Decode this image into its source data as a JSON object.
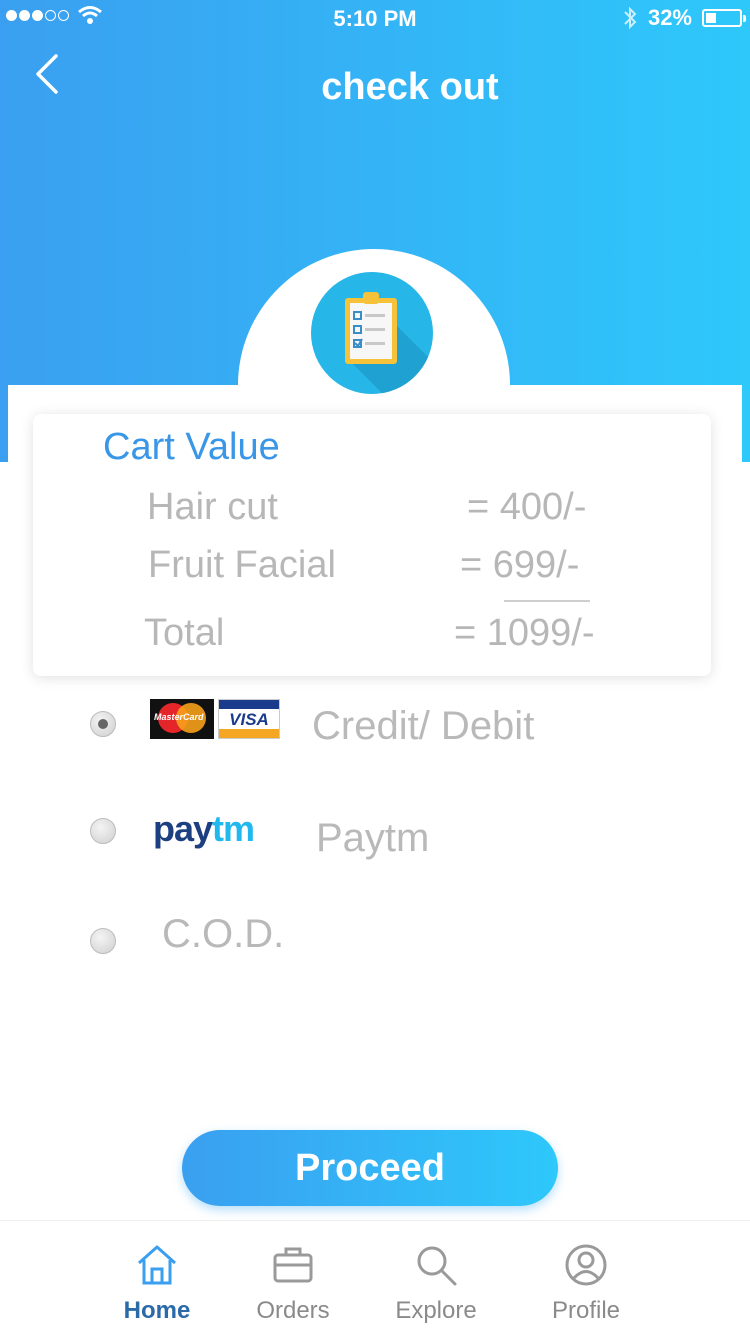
{
  "status_bar": {
    "time": "5:10 PM",
    "battery_percent": "32%",
    "battery_level": 0.32
  },
  "header": {
    "title": "check out"
  },
  "cart": {
    "title": "Cart Value",
    "items": [
      {
        "name": "Hair cut",
        "value": "= 400/-"
      },
      {
        "name": "Fruit Facial",
        "value": "= 699/-"
      }
    ],
    "total": {
      "name": "Total",
      "value": "= 1099/-"
    }
  },
  "payment": {
    "options": [
      {
        "label": "Credit/ Debit",
        "selected": true,
        "icons": [
          "mastercard-icon",
          "visa-icon"
        ]
      },
      {
        "label": "Paytm",
        "selected": false,
        "icons": [
          "paytm-icon"
        ]
      },
      {
        "label": "C.O.D.",
        "selected": false,
        "icons": []
      }
    ],
    "logo_text": {
      "mastercard": "MasterCard",
      "visa": "VISA",
      "paytm_pay": "pay",
      "paytm_tm": "tm"
    }
  },
  "actions": {
    "proceed_label": "Proceed"
  },
  "tabbar": {
    "tabs": [
      {
        "label": "Home",
        "icon": "home-icon",
        "active": true
      },
      {
        "label": "Orders",
        "icon": "briefcase-icon",
        "active": false
      },
      {
        "label": "Explore",
        "icon": "search-icon",
        "active": false
      },
      {
        "label": "Profile",
        "icon": "profile-icon",
        "active": false
      }
    ]
  },
  "colors": {
    "header_gradient_start": "#3a9ff0",
    "header_gradient_end": "#2ec8fb",
    "cart_title": "#3a96e6",
    "muted_text": "#b7b7b7",
    "active_tab": "#2a6aa8"
  }
}
